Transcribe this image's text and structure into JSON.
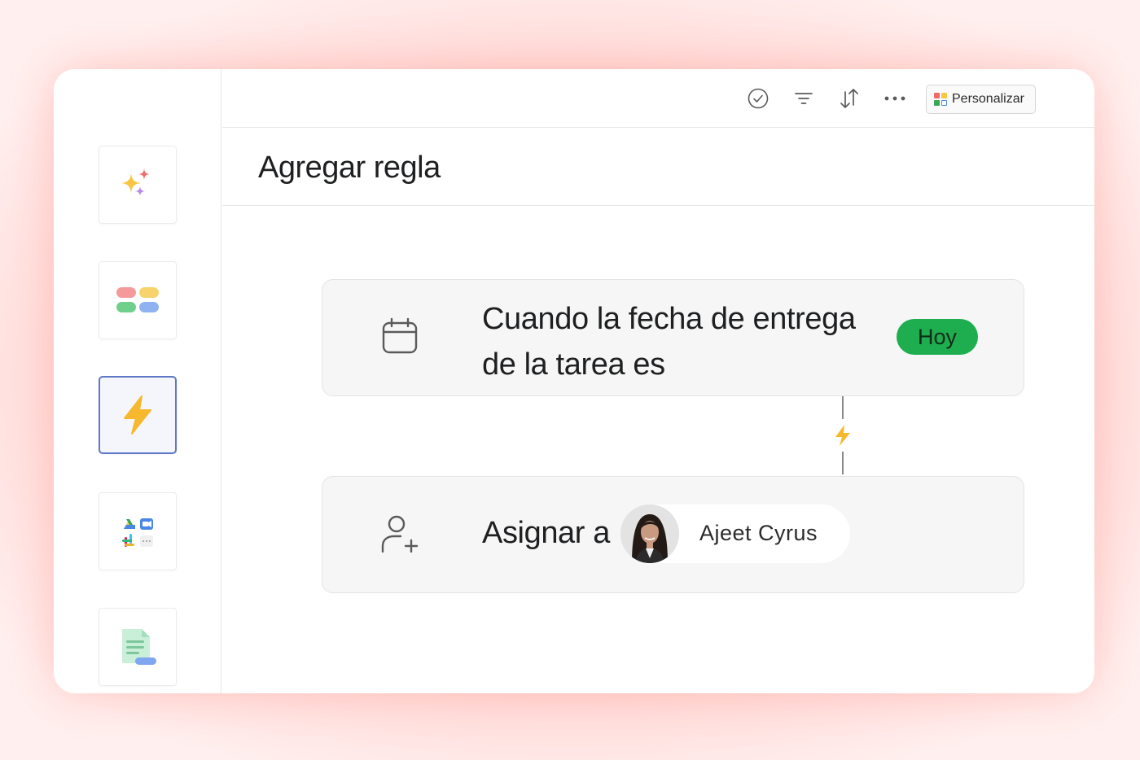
{
  "app": {
    "title": "Agregar regla"
  },
  "sidebar": {
    "items": [
      {
        "name": "ai-sparkles",
        "icon": "sparkles-icon",
        "active": false
      },
      {
        "name": "views",
        "icon": "views-pills-icon",
        "active": false
      },
      {
        "name": "rules",
        "icon": "lightning-bolt-icon",
        "active": true
      },
      {
        "name": "apps",
        "icon": "integrations-icon",
        "active": false
      },
      {
        "name": "forms",
        "icon": "form-document-icon",
        "active": false
      }
    ]
  },
  "toolbar": {
    "icons": [
      "check-circle-icon",
      "filter-icon",
      "sort-icon",
      "more-icon"
    ],
    "personalize_label": "Personalizar"
  },
  "rule": {
    "trigger": {
      "icon": "calendar-icon",
      "text": "Cuando la fecha de entrega de la tarea es",
      "value": "Hoy"
    },
    "action": {
      "icon": "add-user-icon",
      "text": "Asignar a",
      "assignee": "Ajeet Cyrus"
    }
  },
  "colors": {
    "accent_active": "#5f77c7",
    "pill_green": "#1fae4f",
    "bolt_yellow": "#f5b82e",
    "background_pink": "#ffc6c2"
  }
}
